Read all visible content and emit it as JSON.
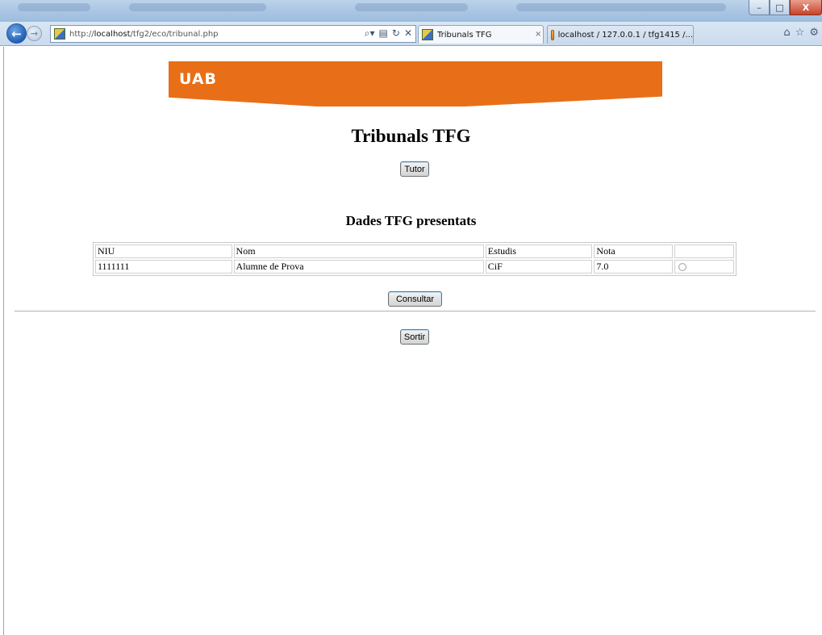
{
  "browser": {
    "url_prefix": "http://",
    "url_host": "localhost",
    "url_path": "/tfg2/eco/tribunal.php",
    "tabs": [
      {
        "label": "Tribunals TFG",
        "active": true
      },
      {
        "label": "localhost / 127.0.0.1 / tfg1415 /...",
        "active": false
      }
    ],
    "tab_close_glyph": "×",
    "win_min": "–",
    "win_max": "□",
    "win_close": "X"
  },
  "header": {
    "logo_text": "UAB",
    "brand_color": "#e86f17"
  },
  "page": {
    "title": "Tribunals TFG",
    "tutor_button": "Tutor",
    "section_title": "Dades TFG presentats",
    "consultar_button": "Consultar",
    "sortir_button": "Sortir"
  },
  "table": {
    "headers": [
      "NIU",
      "Nom",
      "Estudis",
      "Nota",
      ""
    ],
    "rows": [
      {
        "niu": "1111111",
        "nom": "Alumne de Prova",
        "estudis": "CiF",
        "nota": "7.0",
        "selected": false
      }
    ]
  }
}
